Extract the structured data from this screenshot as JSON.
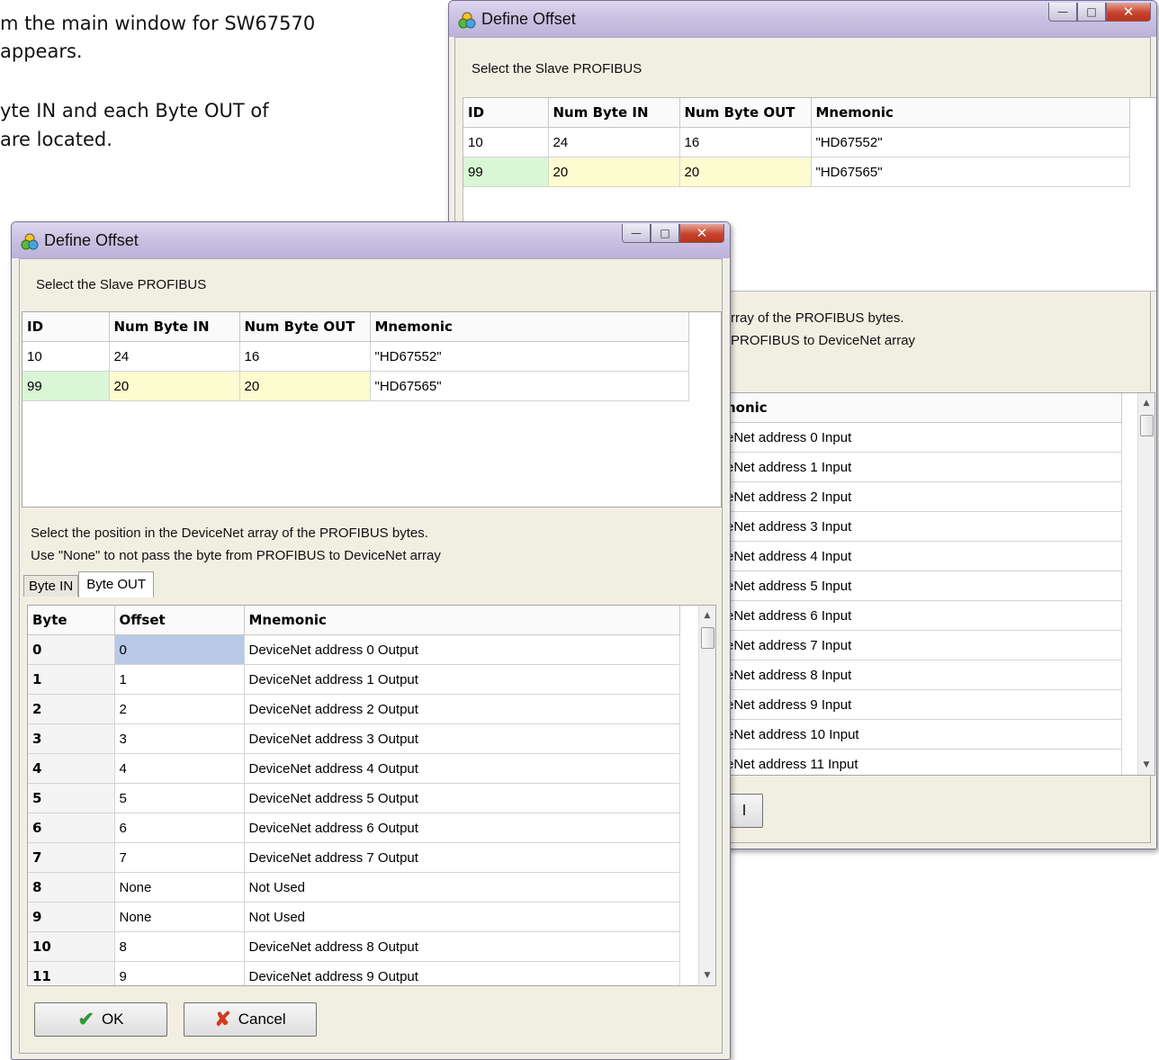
{
  "doc": {
    "line1": "m the main  window for SW67570",
    "line2": "appears.",
    "line3": "yte IN and each Byte OUT of",
    "line4": "are located."
  },
  "back_window": {
    "title": "Define Offset",
    "select_label": "Select the Slave PROFIBUS",
    "slave_headers": [
      "ID",
      "Num Byte IN",
      "Num Byte OUT",
      "Mnemonic"
    ],
    "slave_rows": [
      [
        "10",
        "24",
        "16",
        "\"HD67552\""
      ],
      [
        "99",
        "20",
        "20",
        "\"HD67565\""
      ]
    ],
    "pos_line1": "rray of the PROFIBUS bytes.",
    "pos_line2": "PROFIBUS to DeviceNet array",
    "grid_header": "nonic",
    "grid_rows": [
      "eNet address 0 Input",
      "eNet address 1 Input",
      "eNet address 2 Input",
      "eNet address 3 Input",
      "eNet address 4 Input",
      "eNet address 5 Input",
      "eNet address 6 Input",
      "eNet address 7 Input",
      "eNet address 8 Input",
      "eNet address 9 Input",
      "eNet address 10 Input",
      "eNet address 11 Input"
    ],
    "cancel_fragment": "l"
  },
  "front_window": {
    "title": "Define Offset",
    "select_label": "Select the Slave PROFIBUS",
    "slave_headers": [
      "ID",
      "Num Byte IN",
      "Num Byte OUT",
      "Mnemonic"
    ],
    "slave_rows": [
      [
        "10",
        "24",
        "16",
        "\"HD67552\""
      ],
      [
        "99",
        "20",
        "20",
        "\"HD67565\""
      ]
    ],
    "pos_line1": "Select the position in the DeviceNet array of the PROFIBUS bytes.",
    "pos_line2": "Use \"None\" to not pass the byte from PROFIBUS to DeviceNet array",
    "tabs": [
      "Byte IN",
      "Byte OUT"
    ],
    "grid_headers": [
      "Byte",
      "Offset",
      "Mnemonic"
    ],
    "grid_rows": [
      [
        "0",
        "0",
        "DeviceNet address 0 Output"
      ],
      [
        "1",
        "1",
        "DeviceNet address 1 Output"
      ],
      [
        "2",
        "2",
        "DeviceNet address 2 Output"
      ],
      [
        "3",
        "3",
        "DeviceNet address 3 Output"
      ],
      [
        "4",
        "4",
        "DeviceNet address 4 Output"
      ],
      [
        "5",
        "5",
        "DeviceNet address 5 Output"
      ],
      [
        "6",
        "6",
        "DeviceNet address 6 Output"
      ],
      [
        "7",
        "7",
        "DeviceNet address 7 Output"
      ],
      [
        "8",
        "None",
        "Not Used"
      ],
      [
        "9",
        "None",
        "Not Used"
      ],
      [
        "10",
        "8",
        "DeviceNet address 8 Output"
      ],
      [
        "11",
        "9",
        "DeviceNet address 9 Output"
      ]
    ],
    "ok_label": "OK",
    "cancel_label": "Cancel"
  },
  "colors": {
    "selected_row": "#b7c9e6",
    "id_green": "#d9f7d4",
    "yellow": "#fdfbd0"
  }
}
